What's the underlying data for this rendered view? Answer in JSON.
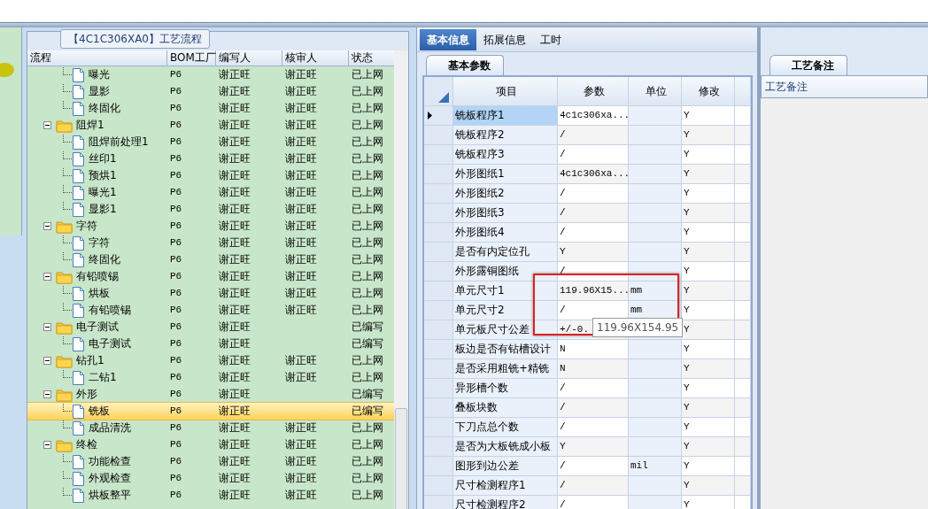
{
  "process_tree": {
    "title": "【4C1C306XA0】工艺流程",
    "columns": [
      "流程",
      "BOM工厂",
      "编写人",
      "核审人",
      "状态"
    ],
    "rows": [
      {
        "kind": "partial-group",
        "children": [
          {
            "label": "曝光",
            "bom": "P6",
            "writer": "谢正旺",
            "reviewer": "谢正旺",
            "status": "已上网",
            "selected": false
          },
          {
            "label": "显影",
            "bom": "P6",
            "writer": "谢正旺",
            "reviewer": "谢正旺",
            "status": "已上网",
            "selected": false
          },
          {
            "label": "终固化",
            "bom": "P6",
            "writer": "谢正旺",
            "reviewer": "谢正旺",
            "status": "已上网",
            "selected": false
          }
        ]
      },
      {
        "kind": "group",
        "label": "阻焊1",
        "bom": "P6",
        "writer": "谢正旺",
        "reviewer": "谢正旺",
        "status": "已上网",
        "selected": false,
        "expanded": true,
        "children": [
          {
            "label": "阻焊前处理1",
            "bom": "P6",
            "writer": "谢正旺",
            "reviewer": "谢正旺",
            "status": "已上网",
            "selected": false
          },
          {
            "label": "丝印1",
            "bom": "P6",
            "writer": "谢正旺",
            "reviewer": "谢正旺",
            "status": "已上网",
            "selected": false
          },
          {
            "label": "预烘1",
            "bom": "P6",
            "writer": "谢正旺",
            "reviewer": "谢正旺",
            "status": "已上网",
            "selected": false
          },
          {
            "label": "曝光1",
            "bom": "P6",
            "writer": "谢正旺",
            "reviewer": "谢正旺",
            "status": "已上网",
            "selected": false
          },
          {
            "label": "显影1",
            "bom": "P6",
            "writer": "谢正旺",
            "reviewer": "谢正旺",
            "status": "已上网",
            "selected": false
          }
        ]
      },
      {
        "kind": "group",
        "label": "字符",
        "bom": "P6",
        "writer": "谢正旺",
        "reviewer": "谢正旺",
        "status": "已上网",
        "selected": false,
        "expanded": true,
        "children": [
          {
            "label": "字符",
            "bom": "P6",
            "writer": "谢正旺",
            "reviewer": "谢正旺",
            "status": "已上网",
            "selected": false
          },
          {
            "label": "终固化",
            "bom": "P6",
            "writer": "谢正旺",
            "reviewer": "谢正旺",
            "status": "已上网",
            "selected": false
          }
        ]
      },
      {
        "kind": "group",
        "label": "有铅喷锡",
        "bom": "P6",
        "writer": "谢正旺",
        "reviewer": "谢正旺",
        "status": "已上网",
        "selected": false,
        "expanded": true,
        "children": [
          {
            "label": "烘板",
            "bom": "P6",
            "writer": "谢正旺",
            "reviewer": "谢正旺",
            "status": "已上网",
            "selected": false
          },
          {
            "label": "有铅喷锡",
            "bom": "P6",
            "writer": "谢正旺",
            "reviewer": "谢正旺",
            "status": "已上网",
            "selected": false
          }
        ]
      },
      {
        "kind": "group",
        "label": "电子测试",
        "bom": "P6",
        "writer": "谢正旺",
        "status": "已编写",
        "selected": false,
        "expanded": true,
        "children": [
          {
            "label": "电子测试",
            "bom": "P6",
            "writer": "谢正旺",
            "status": "已编写",
            "selected": false
          }
        ]
      },
      {
        "kind": "group",
        "label": "钻孔1",
        "bom": "P6",
        "writer": "谢正旺",
        "reviewer": "谢正旺",
        "status": "已上网",
        "selected": false,
        "expanded": true,
        "children": [
          {
            "label": "二钻1",
            "bom": "P6",
            "writer": "谢正旺",
            "reviewer": "谢正旺",
            "status": "已上网",
            "selected": false
          }
        ]
      },
      {
        "kind": "group",
        "label": "外形",
        "bom": "P6",
        "writer": "谢正旺",
        "status": "已编写",
        "selected": false,
        "expanded": true,
        "children": [
          {
            "label": "铣板",
            "bom": "P6",
            "writer": "谢正旺",
            "status": "已编写",
            "selected": true
          },
          {
            "label": "成品清洗",
            "bom": "P6",
            "writer": "谢正旺",
            "reviewer": "谢正旺",
            "status": "已上网",
            "selected": false
          }
        ]
      },
      {
        "kind": "group",
        "label": "终检",
        "bom": "P6",
        "writer": "谢正旺",
        "reviewer": "谢正旺",
        "status": "已上网",
        "selected": false,
        "expanded": true,
        "children": [
          {
            "label": "功能检查",
            "bom": "P6",
            "writer": "谢正旺",
            "reviewer": "谢正旺",
            "status": "已上网",
            "selected": false
          },
          {
            "label": "外观检查",
            "bom": "P6",
            "writer": "谢正旺",
            "reviewer": "谢正旺",
            "status": "已上网",
            "selected": false
          },
          {
            "label": "烘板整平",
            "bom": "P6",
            "writer": "谢正旺",
            "reviewer": "谢正旺",
            "status": "已上网",
            "selected": false
          }
        ]
      }
    ]
  },
  "info_tabs": [
    {
      "label": "基本信息",
      "selected": true
    },
    {
      "label": "拓展信息",
      "selected": false
    },
    {
      "label": "工时",
      "selected": false
    }
  ],
  "params": {
    "tab": "基本参数",
    "columns": [
      "项目",
      "参数",
      "单位",
      "修改"
    ],
    "rows": [
      {
        "item": "铣板程序1",
        "param": "4c1c306xa...",
        "modify": "Y",
        "selected": true
      },
      {
        "item": "铣板程序2",
        "param": "/",
        "modify": "Y",
        "selected": false
      },
      {
        "item": "铣板程序3",
        "param": "/",
        "modify": "Y",
        "selected": false
      },
      {
        "item": "外形图纸1",
        "param": "4c1c306xa...",
        "modify": "Y",
        "selected": false
      },
      {
        "item": "外形图纸2",
        "param": "/",
        "modify": "Y",
        "selected": false
      },
      {
        "item": "外形图纸3",
        "param": "/",
        "modify": "Y",
        "selected": false
      },
      {
        "item": "外形图纸4",
        "param": "/",
        "modify": "Y",
        "selected": false
      },
      {
        "item": "是否有内定位孔",
        "param": "Y",
        "modify": "Y",
        "selected": false
      },
      {
        "item": "外形露铜图纸",
        "param": "/",
        "modify": "Y",
        "selected": false
      },
      {
        "item": "单元尺寸1",
        "param": "119.96X15...",
        "unit": "mm",
        "modify": "Y",
        "selected": false
      },
      {
        "item": "单元尺寸2",
        "param": "/",
        "unit": "mm",
        "modify": "Y",
        "selected": false
      },
      {
        "item": "单元板尺寸公差",
        "param": "+/-0.",
        "modify": "Y",
        "selected": false
      },
      {
        "item": "板边是否有钻槽设计",
        "param": "N",
        "modify": "Y",
        "selected": false
      },
      {
        "item": "是否采用粗铣+精铣",
        "param": "N",
        "modify": "Y",
        "selected": false
      },
      {
        "item": "异形槽个数",
        "param": "/",
        "modify": "Y",
        "selected": false
      },
      {
        "item": "叠板块数",
        "param": "/",
        "modify": "Y",
        "selected": false
      },
      {
        "item": "下刀点总个数",
        "param": "/",
        "modify": "Y",
        "selected": false
      },
      {
        "item": "是否为大板铣成小板",
        "param": "Y",
        "modify": "Y",
        "selected": false
      },
      {
        "item": "图形到边公差",
        "param": "/",
        "unit": "mil",
        "modify": "Y",
        "selected": false
      },
      {
        "item": "尺寸检测程序1",
        "param": "/",
        "modify": "Y",
        "selected": false
      },
      {
        "item": "尺寸检测程序2",
        "param": "/",
        "modify": "Y",
        "selected": false
      }
    ],
    "tooltip": "119.96X154.95"
  },
  "notes": {
    "tab": "工艺备注",
    "label": "工艺备注"
  }
}
